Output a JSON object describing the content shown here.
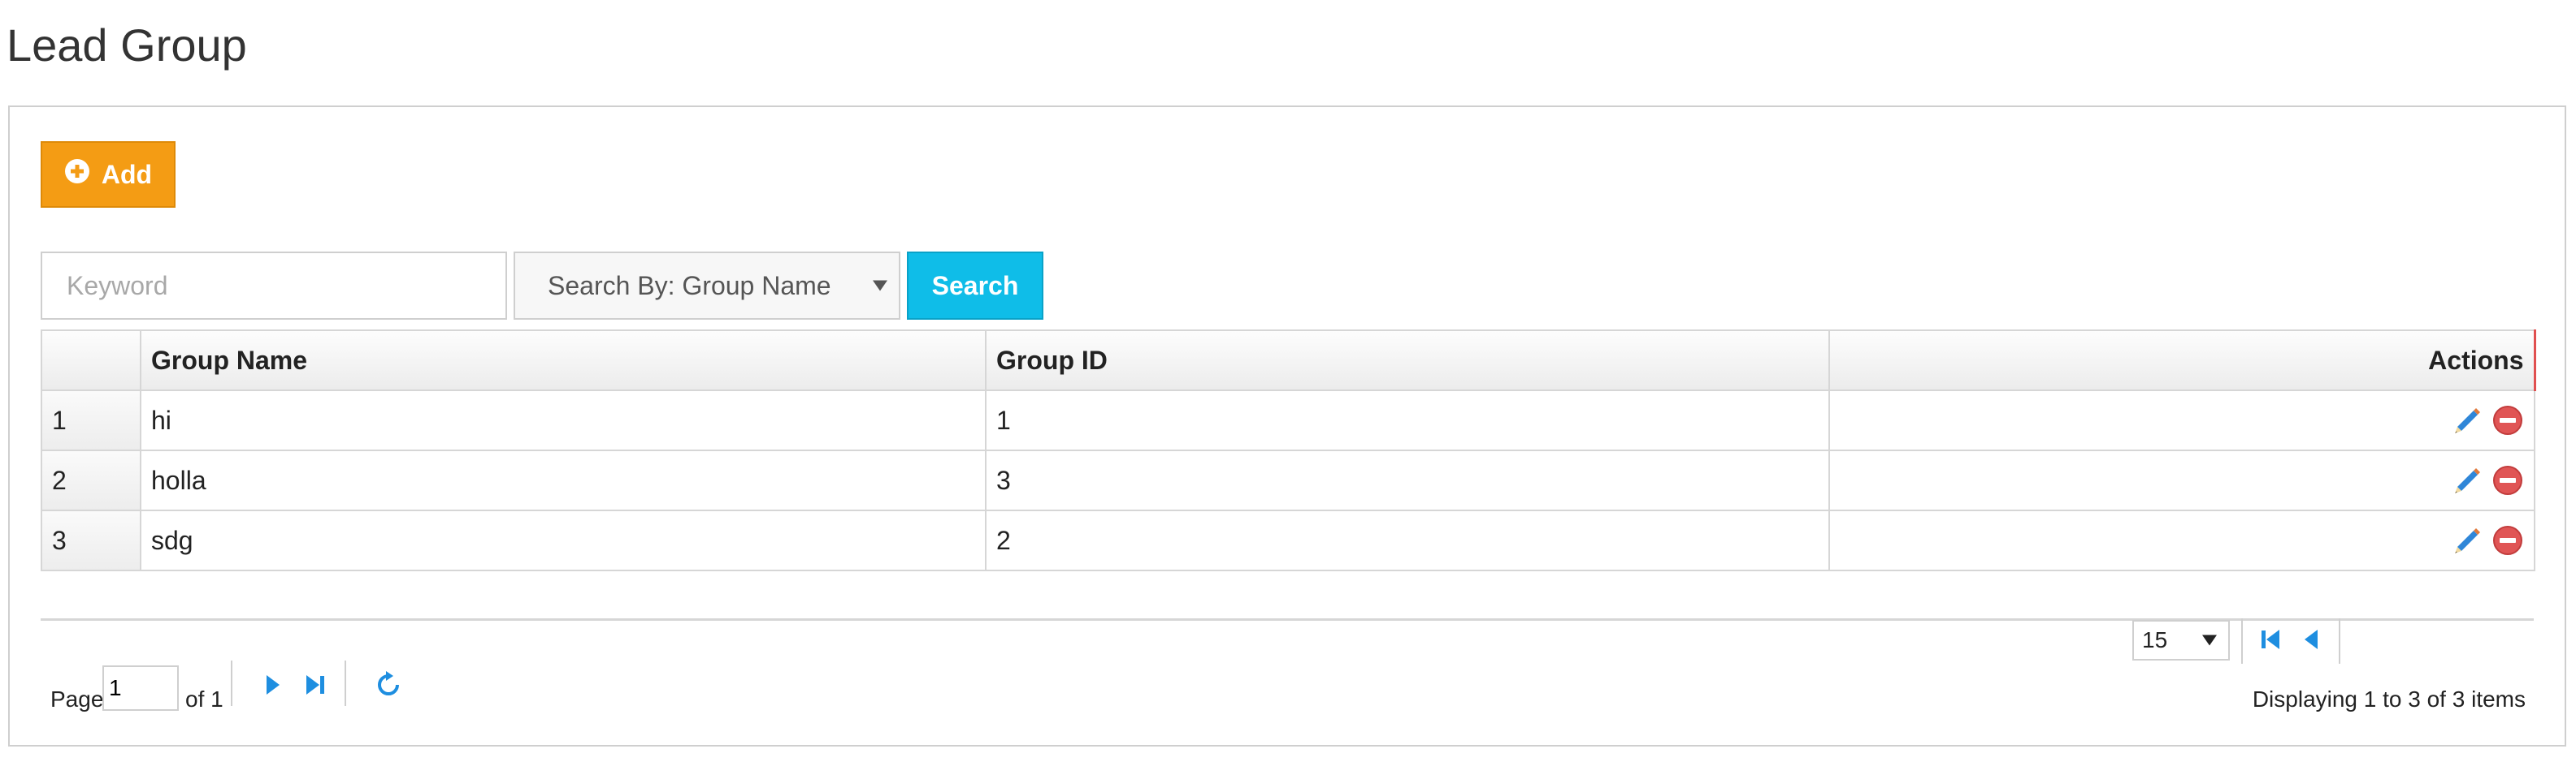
{
  "page": {
    "title": "Lead Group"
  },
  "toolbar": {
    "add_label": "Add"
  },
  "search": {
    "keyword_placeholder": "Keyword",
    "keyword_value": "",
    "search_by_label": "Search By: Group Name",
    "search_button_label": "Search"
  },
  "table": {
    "headers": {
      "num": "",
      "group_name": "Group Name",
      "group_id": "Group ID",
      "actions": "Actions"
    },
    "rows": [
      {
        "num": "1",
        "group_name": "hi",
        "group_id": "1"
      },
      {
        "num": "2",
        "group_name": "holla",
        "group_id": "3"
      },
      {
        "num": "3",
        "group_name": "sdg",
        "group_id": "2"
      }
    ]
  },
  "pager": {
    "page_size": "15",
    "page_label": "Page",
    "current_page": "1",
    "of_label": "of 1",
    "displaying": "Displaying 1 to 3 of 3 items"
  },
  "icons": {
    "add": "plus-circle-icon",
    "edit": "pencil-icon",
    "delete": "minus-circle-icon",
    "first": "first-page-icon",
    "prev": "prev-page-icon",
    "next": "next-page-icon",
    "last": "last-page-icon",
    "refresh": "refresh-icon"
  },
  "colors": {
    "add_button": "#f49c14",
    "search_button": "#0fbde8",
    "pager_icons": "#1e8ee0",
    "delete_icon": "#e05555"
  }
}
